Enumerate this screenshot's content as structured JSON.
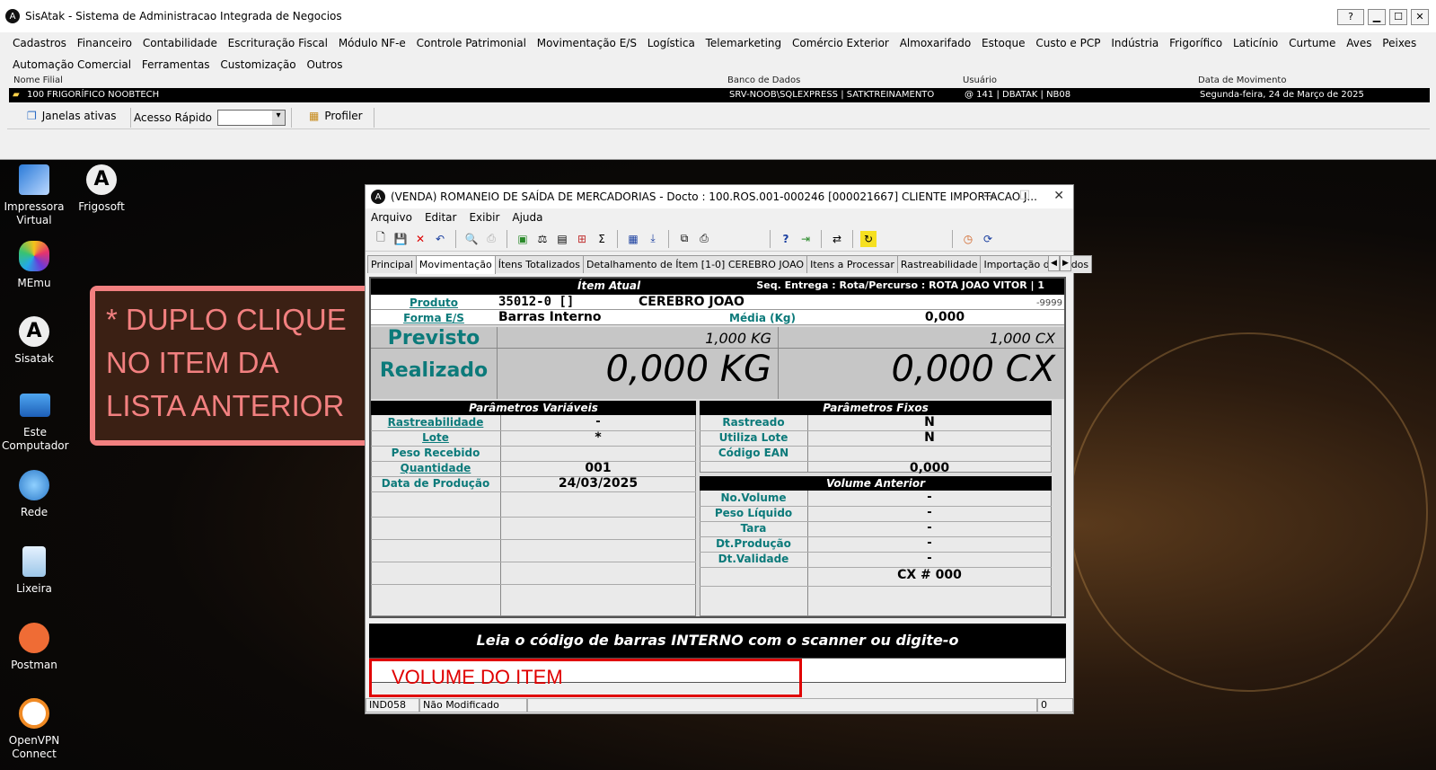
{
  "main_window": {
    "title": "SisAtak - Sistema de Administracao Integrada de Negocios",
    "help_btn": "?",
    "min_btn": "▁",
    "max_btn": "☐",
    "close_btn": "✕"
  },
  "menu": [
    "Cadastros",
    "Financeiro",
    "Contabilidade",
    "Escrituração Fiscal",
    "Módulo NF-e",
    "Controle Patrimonial",
    "Movimentação E/S",
    "Logística",
    "Telemarketing",
    "Comércio Exterior",
    "Almoxarifado",
    "Estoque",
    "Custo e PCP",
    "Indústria",
    "Frigorífico",
    "Laticínio",
    "Curtume",
    "Aves",
    "Peixes",
    "Automação Comercial",
    "Ferramentas",
    "Customização",
    "Outros"
  ],
  "info": {
    "hdr_filial": "Nome Filial",
    "hdr_banco": "Banco de Dados",
    "hdr_usuario": "Usuário",
    "hdr_data": "Data de Movimento",
    "filial": "100 FRIGORÍFICO NOOBTECH",
    "banco": "SRV-NOOB\\SQLEXPRESS | SATKTREINAMENTO",
    "usuario": "@ 141 | DBATAK | NB08",
    "data": "Segunda-feira, 24 de Março de 2025"
  },
  "toolbar": {
    "janelas": "Janelas ativas",
    "acesso": "Acesso Rápido",
    "profiler": "Profiler"
  },
  "desktop_icons": [
    {
      "label": "Impressora Virtual"
    },
    {
      "label": "Frigosoft"
    },
    {
      "label": "MEmu"
    },
    {
      "label": "Sisatak"
    },
    {
      "label": "Este Computador"
    },
    {
      "label": "Rede"
    },
    {
      "label": "Lixeira"
    },
    {
      "label": "Postman"
    },
    {
      "label": "OpenVPN Connect"
    }
  ],
  "note": {
    "text": "* DUPLO CLIQUE NO ITEM DA LISTA ANTERIOR"
  },
  "child": {
    "title": "(VENDA) ROMANEIO DE SAÍDA DE MERCADORIAS - Docto : 100.ROS.001-000246 [000021667] CLIENTE IMPORTACAO J...",
    "menu": [
      "Arquivo",
      "Editar",
      "Exibir",
      "Ajuda"
    ],
    "tabs": [
      "Principal",
      "Movimentação",
      "Ítens Totalizados",
      "Detalhamento de Ítem [1-0] CEREBRO JOAO",
      "Itens a Processar",
      "Rastreabilidade",
      "Importação de dados"
    ]
  },
  "item": {
    "header": "Ítem Atual",
    "seq": "Seq. Entrega : Rota/Percurso : ROTA JOAO VITOR | 1",
    "produto_lbl": "Produto",
    "produto_code": "35012-0  []",
    "produto_name": "CEREBRO JOAO",
    "produto_extra": "-9999",
    "forma_lbl": "Forma E/S",
    "forma_val": "Barras Interno",
    "media_lbl": "Média (Kg)",
    "media_val": "0,000",
    "previsto_lbl": "Previsto",
    "previsto_kg": "1,000 KG",
    "previsto_cx": "1,000 CX",
    "realizado_lbl": "Realizado",
    "realizado_kg": "0,000 KG",
    "realizado_cx": "0,000 CX"
  },
  "param_var": {
    "header": "Parâmetros Variáveis",
    "rows": [
      {
        "label": "Rastreabilidade",
        "value": "-"
      },
      {
        "label": "Lote",
        "value": "*"
      },
      {
        "label": "Peso Recebido",
        "value": ""
      },
      {
        "label": "Quantidade",
        "value": "001"
      },
      {
        "label": "Data de Produção",
        "value": "24/03/2025"
      }
    ]
  },
  "param_fix": {
    "header": "Parâmetros Fixos",
    "rows": [
      {
        "label": "Rastreado",
        "value": "N"
      },
      {
        "label": "Utiliza Lote",
        "value": "N"
      },
      {
        "label": "Código EAN",
        "value": ""
      },
      {
        "label": "",
        "value": "0,000"
      }
    ]
  },
  "vol_ant": {
    "header": "Volume Anterior",
    "rows": [
      {
        "label": "No.Volume",
        "value": "-"
      },
      {
        "label": "Peso Líquido",
        "value": "-"
      },
      {
        "label": "Tara",
        "value": "-"
      },
      {
        "label": "Dt.Produção",
        "value": "-"
      },
      {
        "label": "Dt.Validade",
        "value": "-"
      },
      {
        "label": "",
        "value": "CX # 000"
      }
    ]
  },
  "scan": {
    "text": "Leia o código de barras INTERNO com o scanner ou digite-o"
  },
  "volume_note": "VOLUME DO ITEM",
  "status": {
    "code": "IND058",
    "state": "Não Modificado",
    "count": "0"
  }
}
